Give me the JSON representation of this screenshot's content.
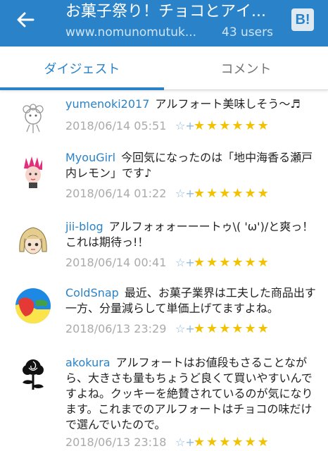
{
  "header": {
    "title": "お菓子祭り！チョコとアイ...",
    "url": "www.nomunomutuk...",
    "users": "43 users",
    "hatena_icon": "B!"
  },
  "tabs": [
    {
      "label": "ダイジェスト",
      "active": true
    },
    {
      "label": "コメント",
      "active": false
    }
  ],
  "comments": [
    {
      "user": "yumenoki2017",
      "text": "アルフォート美味しそう〜♬",
      "date": "2018/06/14 05:51",
      "add_star": "☆+",
      "stars": "★★★★★★"
    },
    {
      "user": "MyouGirl",
      "text": "今回気になったのは「地中海香る瀬戸内レモン」です♪",
      "date": "2018/06/14 01:22",
      "add_star": "☆+",
      "stars": "★★★★★★"
    },
    {
      "user": "jii-blog",
      "text": "アルフォォォーーートゥ\\( 'ω')/と爽っ！これは期待っ!！",
      "date": "2018/06/14 00:41",
      "add_star": "☆+",
      "stars": "★★★★★★"
    },
    {
      "user": "ColdSnap",
      "text": "最近、お菓子業界は工夫した商品出す一方、分量減らして単価上げてますよね。",
      "date": "2018/06/13 23:29",
      "add_star": "☆+",
      "stars": "★★★★★★"
    },
    {
      "user": "akokura",
      "text": "アルフォートはお値段もさることながら、大きさも量もちょうど良くて買いやすいんですよね。クッキーを絶賛されているのが気になります。これまでのアルフォートはチョコの味だけで選んでいたので。",
      "date": "2018/06/13 23:18",
      "add_star": "☆+",
      "stars": "★★★★★★"
    }
  ],
  "colors": {
    "header_bg": "#2a83c9",
    "username": "#2a83c9",
    "star": "#f2c200"
  }
}
